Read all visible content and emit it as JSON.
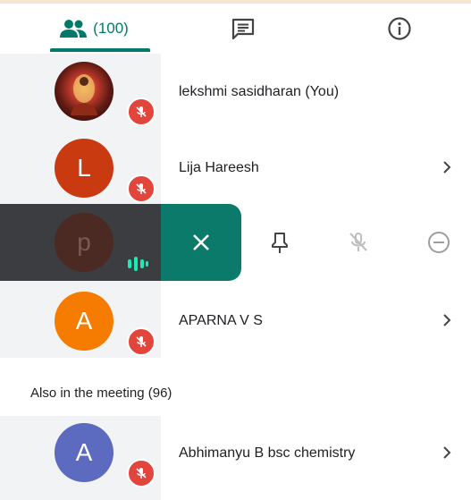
{
  "tabs": {
    "people_count": "(100)",
    "icons": [
      "people-icon",
      "chat-icon",
      "info-icon"
    ]
  },
  "participants": [
    {
      "name": "lekshmi sasidharan (You)",
      "avatar": "photo",
      "muted": true
    },
    {
      "name": "Lija Hareesh",
      "avatar_letter": "L",
      "avatar_color": "#c93a11",
      "muted": true
    },
    {
      "avatar_letter": "p",
      "avatar_color": "#4a2a22",
      "speaking": true
    },
    {
      "name": "APARNA V S",
      "avatar_letter": "A",
      "avatar_color": "#f57c00",
      "muted": true
    }
  ],
  "also_in_meeting": {
    "heading": "Also in the meeting (96)",
    "participants": [
      {
        "name": "Abhimanyu B bsc chemistry",
        "avatar_letter": "A",
        "avatar_color": "#5c6bc0",
        "muted": true
      }
    ]
  },
  "colors": {
    "accent": "#00796b",
    "mute_badge": "#e2453c",
    "avatar_pane": "#f1f3f4",
    "action_dark": "#3c3d40"
  }
}
